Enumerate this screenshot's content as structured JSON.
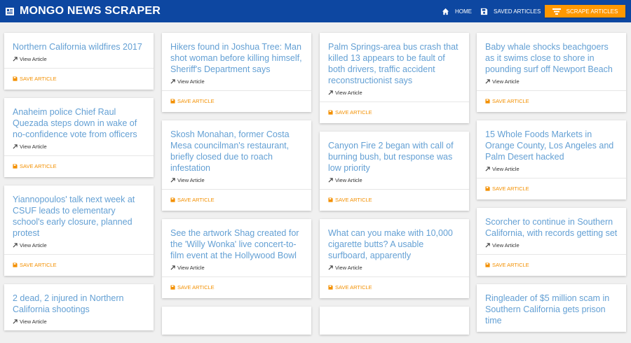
{
  "navbar": {
    "brand": "MONGO NEWS SCRAPER",
    "home_label": "HOME",
    "saved_label": "SAVED ARTICLES",
    "scrape_label": "SCRAPE ARTICLES"
  },
  "article_view_label": "View Article",
  "article_save_label": "SAVE ARTICLE",
  "columns": [
    [
      {
        "title": "Northern California wildfires 2017"
      },
      {
        "title": "Anaheim police Chief Raul Quezada steps down in wake of no-confidence vote from officers"
      },
      {
        "title": "Yiannopoulos' talk next week at CSUF leads to elementary school's early closure, planned protest"
      },
      {
        "title": "2 dead, 2 injured in Northern California shootings"
      }
    ],
    [
      {
        "title": "Hikers found in Joshua Tree: Man shot woman before killing himself, Sheriff's Department says"
      },
      {
        "title": "Skosh Monahan, former Costa Mesa councilman's restaurant, briefly closed due to roach infestation"
      },
      {
        "title": "See the artwork Shag created for the 'Willy Wonka' live concert-to-film event at the Hollywood Bowl"
      },
      {
        "title": ""
      }
    ],
    [
      {
        "title": "Palm Springs-area bus crash that killed 13 appears to be fault of both drivers, traffic accident reconstructionist says"
      },
      {
        "title": "Canyon Fire 2 began with call of burning bush, but response was low priority"
      },
      {
        "title": "What can you make with 10,000 cigarette butts? A usable surfboard, apparently"
      },
      {
        "title": ""
      }
    ],
    [
      {
        "title": "Baby whale shocks beachgoers as it swims close to shore in pounding surf off Newport Beach"
      },
      {
        "title": "15 Whole Foods Markets in Orange County, Los Angeles and Palm Desert hacked"
      },
      {
        "title": "Scorcher to continue in Southern California, with records getting set"
      },
      {
        "title": "Ringleader of $5 million scam in Southern California gets prison time"
      }
    ]
  ]
}
